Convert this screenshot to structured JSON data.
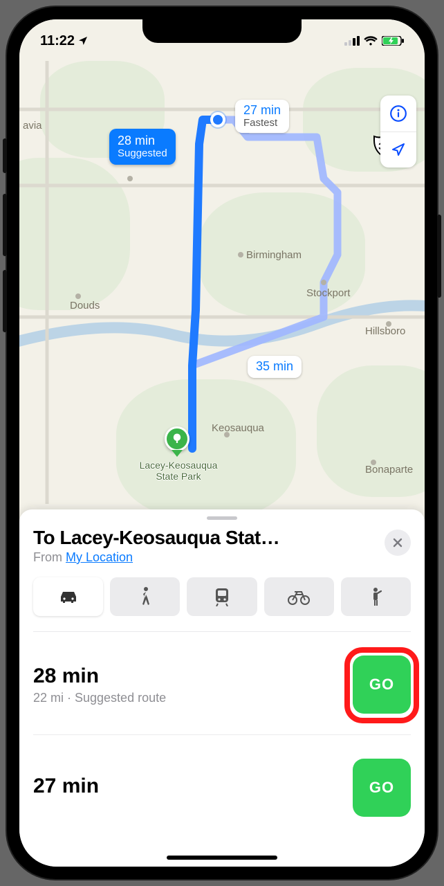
{
  "status": {
    "time": "11:22"
  },
  "map": {
    "callout_suggested": {
      "time": "28 min",
      "label": "Suggested"
    },
    "callout_fastest": {
      "time": "27 min",
      "label": "Fastest"
    },
    "callout_alt": {
      "time": "35 min"
    },
    "cities": {
      "avia": "avia",
      "birmingham": "Birmingham",
      "stockport": "Stockport",
      "douds": "Douds",
      "hillsboro": "Hillsboro",
      "keosauqua": "Keosauqua",
      "bonaparte": "Bonaparte"
    },
    "highway_label": "34",
    "destination_label": "Lacey-Keosauqua\nState Park"
  },
  "sheet": {
    "to_prefix": "To ",
    "destination": "Lacey-Keosauqua Stat…",
    "from_prefix": "From ",
    "from_link": "My Location",
    "modes": [
      "drive",
      "walk",
      "transit",
      "bike",
      "rideshare"
    ]
  },
  "routes": [
    {
      "time": "28 min",
      "sub": "22 mi · Suggested route",
      "go": "GO"
    },
    {
      "time": "27 min",
      "sub": "",
      "go": "GO"
    }
  ]
}
